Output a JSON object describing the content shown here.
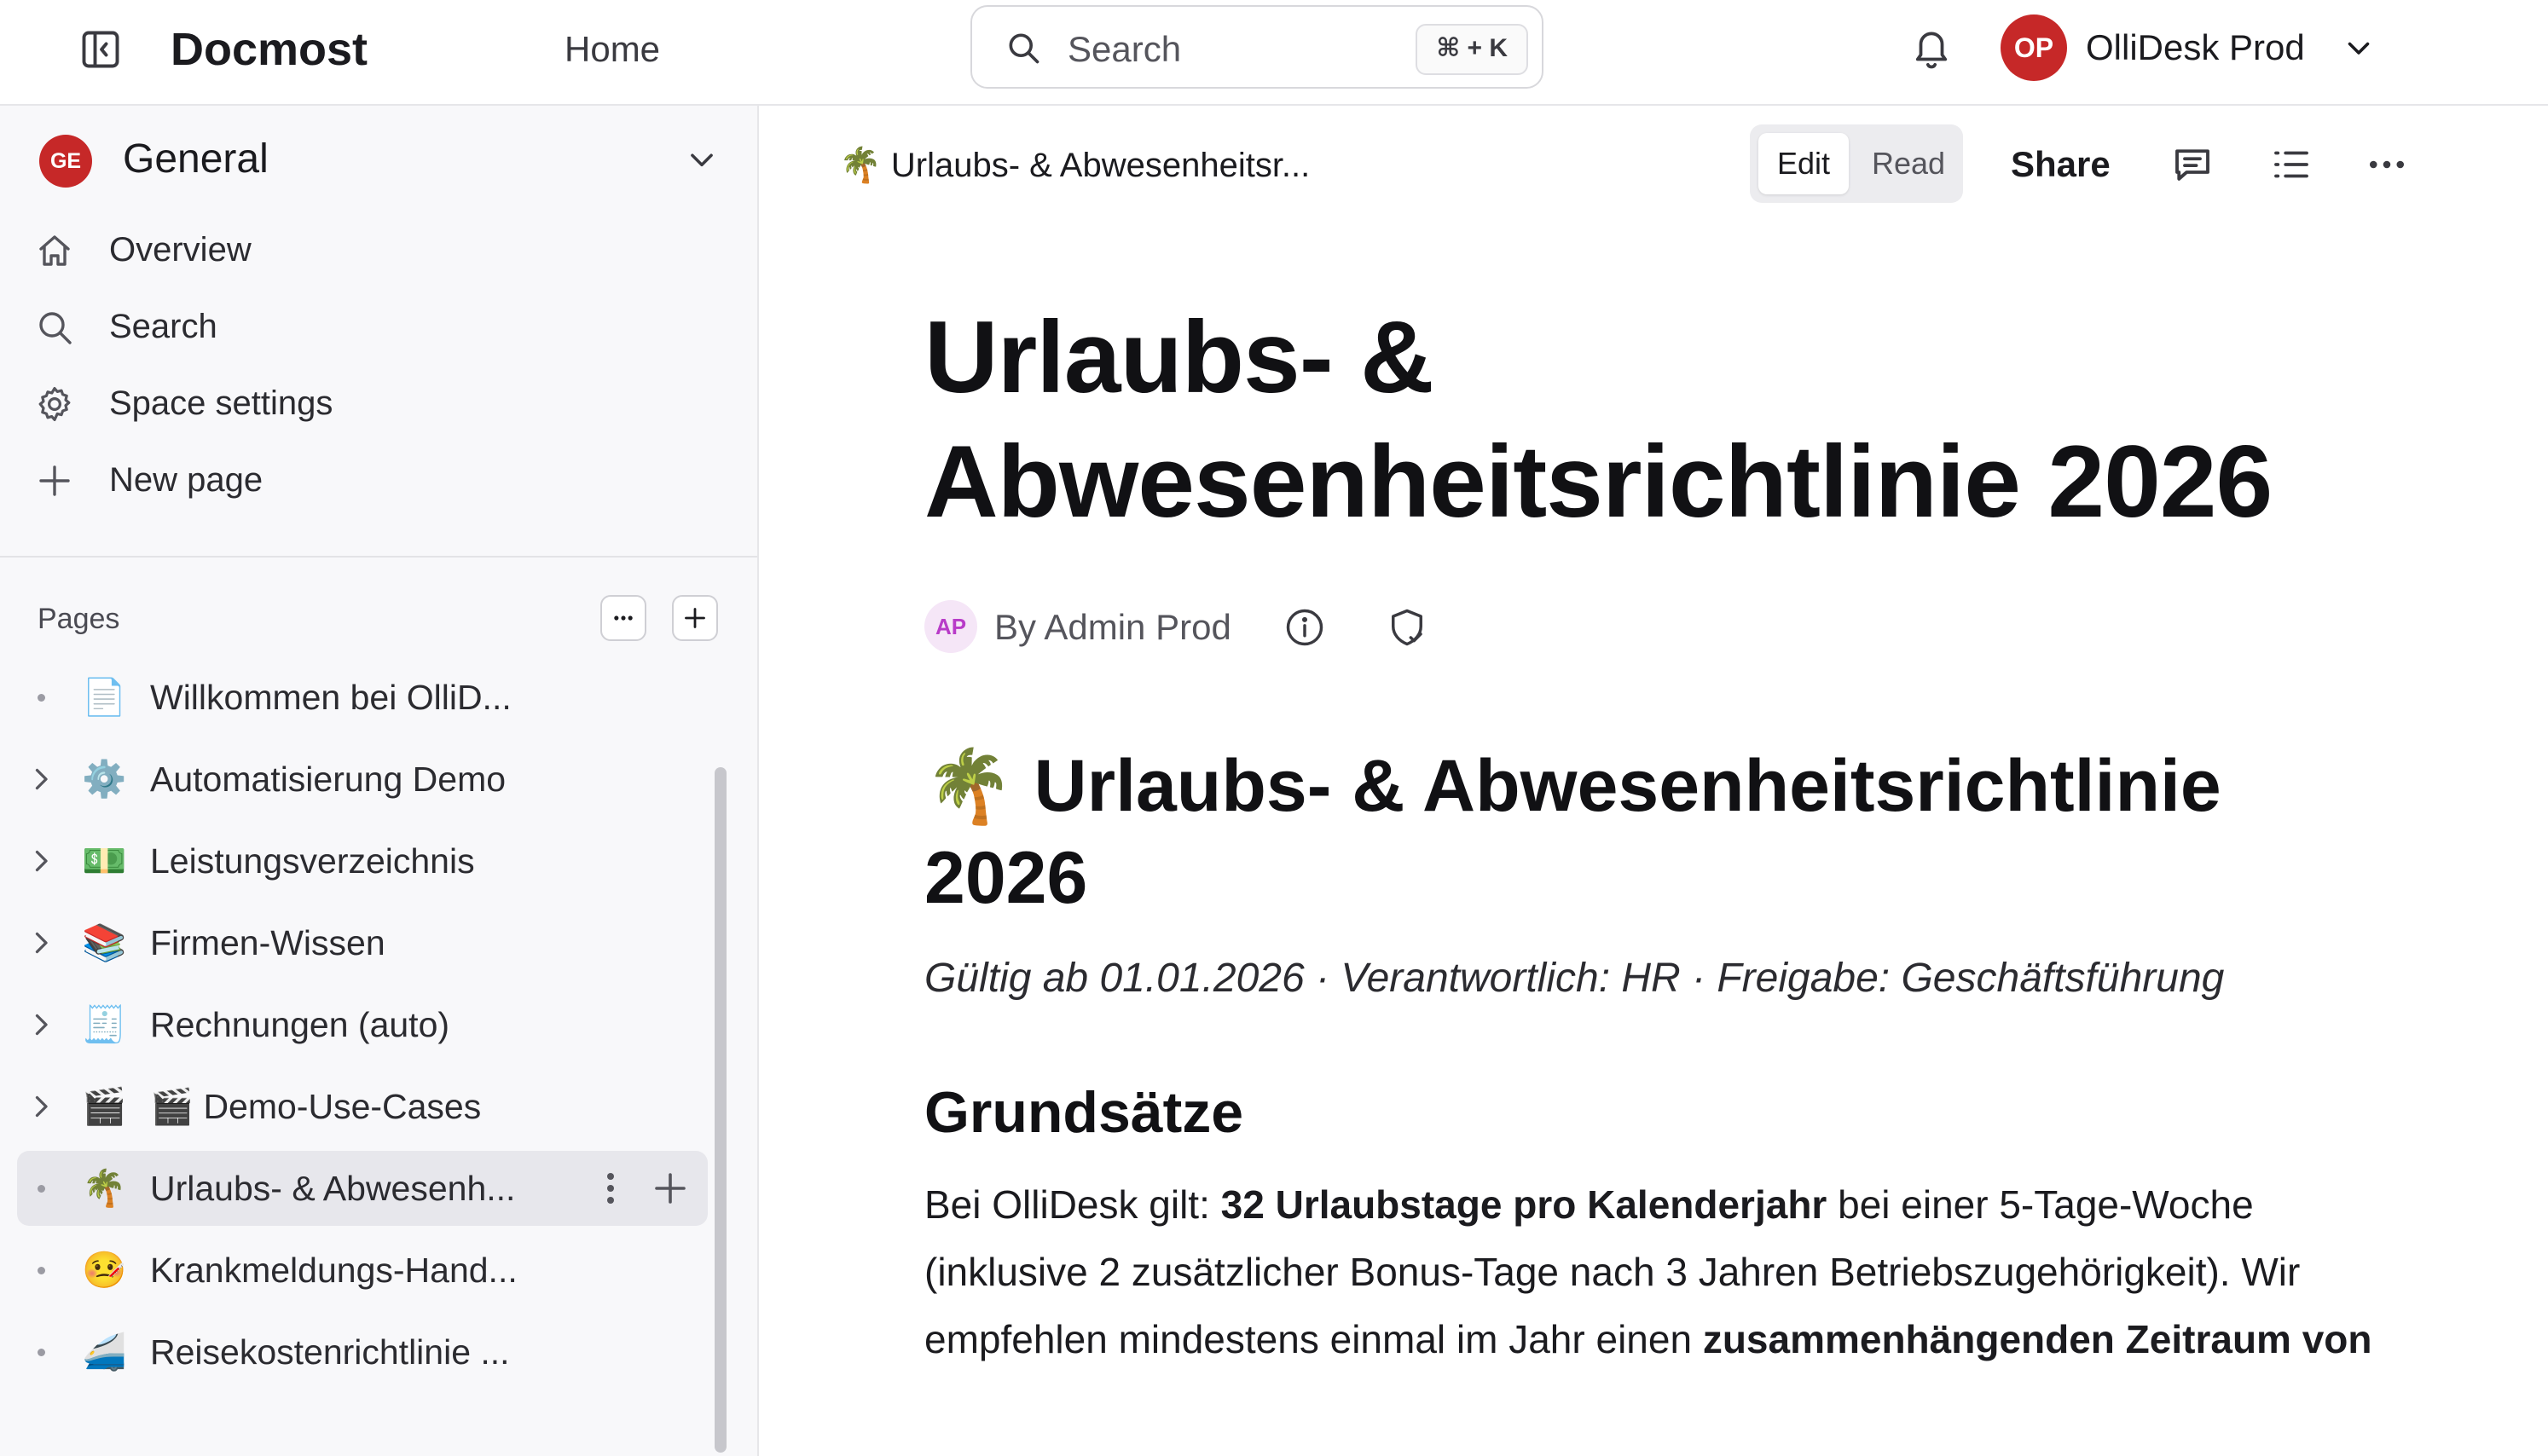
{
  "app": {
    "name": "Docmost",
    "home_label": "Home",
    "search_placeholder": "Search",
    "search_shortcut": "⌘ + K",
    "workspace": {
      "initials": "OP",
      "name": "OlliDesk Prod"
    }
  },
  "sidebar": {
    "space": {
      "initials": "GE",
      "name": "General"
    },
    "nav": [
      {
        "label": "Overview",
        "icon": "home-icon"
      },
      {
        "label": "Search",
        "icon": "search-icon"
      },
      {
        "label": "Space settings",
        "icon": "gear-icon"
      },
      {
        "label": "New page",
        "icon": "plus-icon"
      }
    ],
    "pages_label": "Pages",
    "pages": [
      {
        "emoji": "📄",
        "label": "Willkommen bei OlliD...",
        "has_children": false,
        "active": false
      },
      {
        "emoji": "⚙️",
        "label": "Automatisierung Demo",
        "has_children": true,
        "active": false
      },
      {
        "emoji": "💵",
        "label": "Leistungsverzeichnis",
        "has_children": true,
        "active": false
      },
      {
        "emoji": "📚",
        "label": "Firmen-Wissen",
        "has_children": true,
        "active": false
      },
      {
        "emoji": "🧾",
        "label": "Rechnungen (auto)",
        "has_children": true,
        "active": false
      },
      {
        "emoji": "🎬",
        "label": "🎬 Demo-Use-Cases",
        "has_children": true,
        "active": false
      },
      {
        "emoji": "🌴",
        "label": "Urlaubs- & Abwesenh...",
        "has_children": false,
        "active": true
      },
      {
        "emoji": "🤒",
        "label": "Krankmeldungs-Hand...",
        "has_children": false,
        "active": false
      },
      {
        "emoji": "🚄",
        "label": "Reisekostenrichtlinie ...",
        "has_children": false,
        "active": false
      }
    ]
  },
  "page_header": {
    "breadcrumb": "🌴 Urlaubs- & Abwesenheitsr...",
    "mode_edit": "Edit",
    "mode_read": "Read",
    "share_label": "Share"
  },
  "document": {
    "title": "Urlaubs- & Abwesenheitsrichtlinie 2026",
    "author_initials": "AP",
    "author": "By Admin Prod",
    "heading_emoji": "🌴",
    "heading": "Urlaubs- & Abwesenheitsrichtlinie 2026",
    "meta_line": "Gültig ab 01.01.2026 · Verantwortlich: HR · Freigabe: Geschäftsführung",
    "section_heading": "Grundsätze",
    "paragraph": {
      "p1": "Bei OlliDesk gilt: ",
      "b1": "32 Urlaubstage pro Kalenderjahr",
      "p2": " bei einer 5-Tage-Woche (inklusive 2 zusätzlicher Bonus-Tage nach 3 Jahren Betriebszugehörigkeit). Wir empfehlen mindestens einmal im Jahr einen ",
      "b2": "zusammenhängenden Zeitraum von"
    }
  }
}
